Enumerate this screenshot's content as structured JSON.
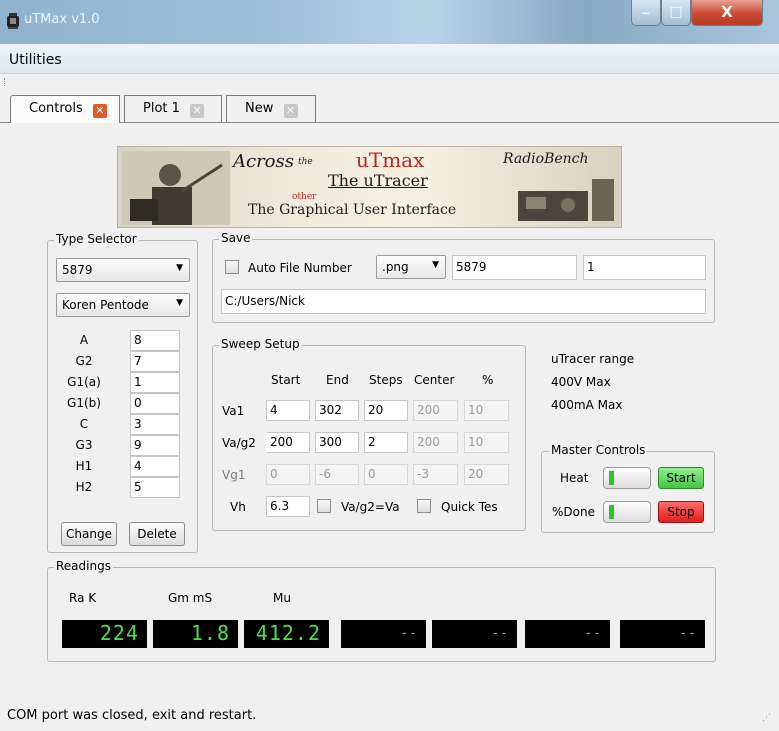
{
  "window": {
    "title": "uTMax v1.0",
    "close_glyph": "X",
    "min_glyph": "_",
    "max_glyph": "□"
  },
  "menu": {
    "utilities": "Utilities"
  },
  "tabs": [
    {
      "label": "Controls",
      "close": "✕"
    },
    {
      "label": "Plot 1",
      "close": "✕"
    },
    {
      "label": "New",
      "close": "✕"
    }
  ],
  "banner": {
    "across": "Across",
    "the": "the",
    "utmax": "uTmax",
    "utracer": "The uTracer",
    "other": "other",
    "gui": "The Graphical User Interface",
    "radiobench": "RadioBench"
  },
  "type_selector": {
    "legend": "Type Selector",
    "tube": "5879",
    "model": "Koren Pentode",
    "params": [
      {
        "label": "A",
        "value": "8"
      },
      {
        "label": "G2",
        "value": "7"
      },
      {
        "label": "G1(a)",
        "value": "1"
      },
      {
        "label": "G1(b)",
        "value": "0"
      },
      {
        "label": "C",
        "value": "3"
      },
      {
        "label": "G3",
        "value": "9"
      },
      {
        "label": "H1",
        "value": "4"
      },
      {
        "label": "H2",
        "value": "5"
      }
    ],
    "change": "Change",
    "delete": "Delete"
  },
  "save": {
    "legend": "Save",
    "auto_label": "Auto File Number",
    "format": ".png",
    "name": "5879",
    "number": "1",
    "path": "C:/Users/Nick"
  },
  "sweep": {
    "legend": "Sweep Setup",
    "headers": [
      "Start",
      "End",
      "Steps",
      "Center",
      "%"
    ],
    "rows": [
      {
        "label": "Va1",
        "values": [
          "4",
          "302",
          "20",
          "200",
          "10"
        ]
      },
      {
        "label": "Va/g2",
        "values": [
          "200",
          "300",
          "2",
          "200",
          "10"
        ]
      },
      {
        "label": "Vg1",
        "values": [
          "0",
          "-6",
          "0",
          "-3",
          "20"
        ]
      }
    ],
    "vh_label": "Vh",
    "vh_value": "6.3",
    "vag2_label": "Va/g2=Va",
    "quick_label": "Quick Tes"
  },
  "range": {
    "title": "uTracer range",
    "max_v": "400V Max",
    "max_ma": "400mA Max"
  },
  "master": {
    "legend": "Master Controls",
    "heat": "Heat",
    "done": "%Done",
    "start": "Start",
    "stop": "Stop"
  },
  "readings": {
    "legend": "Readings",
    "labels": [
      "Ra K",
      "Gm mS",
      "Mu"
    ],
    "displays": [
      "224",
      "1.8",
      "412.2",
      "--",
      "--",
      "--",
      "--"
    ]
  },
  "status": "COM port was closed, exit and restart.",
  "colors": {
    "lcd_text": "#47e34a",
    "start": "#46c346",
    "stop": "#e21e1e",
    "tab_close": "#e05a2a"
  }
}
